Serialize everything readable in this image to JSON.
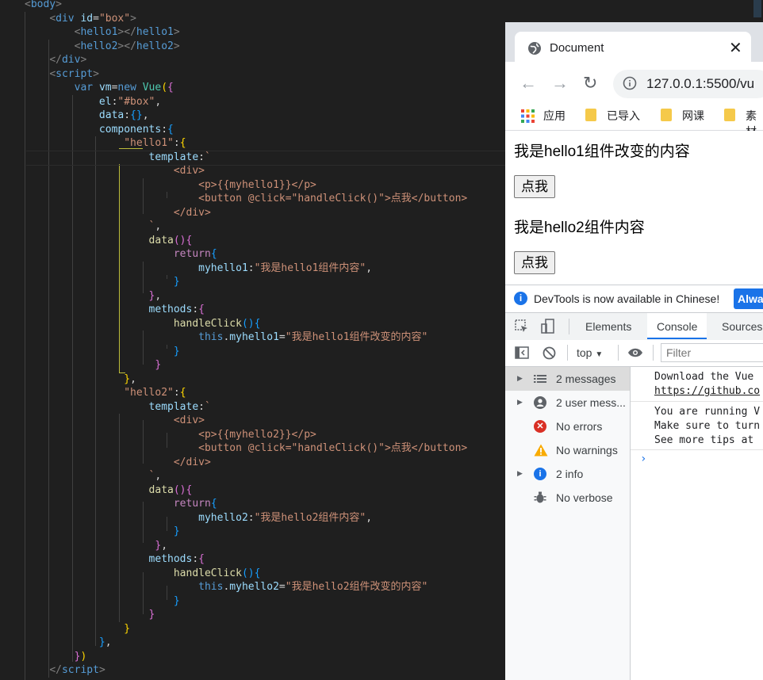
{
  "editor": {
    "lines": [
      [
        [
          "<",
          "p"
        ],
        [
          "body",
          "tag"
        ],
        [
          ">",
          "p"
        ]
      ],
      [
        [
          "    "
        ],
        [
          "<",
          "p"
        ],
        [
          "div",
          "tag"
        ],
        [
          " "
        ],
        [
          "id",
          "attr"
        ],
        [
          "=",
          "plain"
        ],
        [
          "\"box\"",
          "str"
        ],
        [
          ">",
          "p"
        ]
      ],
      [
        [
          "        "
        ],
        [
          "<",
          "p"
        ],
        [
          "hello1",
          "tag"
        ],
        [
          "></",
          "p"
        ],
        [
          "hello1",
          "tag"
        ],
        [
          ">",
          "p"
        ]
      ],
      [
        [
          "        "
        ],
        [
          "<",
          "p"
        ],
        [
          "hello2",
          "tag"
        ],
        [
          "></",
          "p"
        ],
        [
          "hello2",
          "tag"
        ],
        [
          ">",
          "p"
        ]
      ],
      [
        [
          "    "
        ],
        [
          "</",
          "p"
        ],
        [
          "div",
          "tag"
        ],
        [
          ">",
          "p"
        ]
      ],
      [
        [
          "    "
        ],
        [
          "<",
          "p"
        ],
        [
          "script",
          "tag"
        ],
        [
          ">",
          "p"
        ]
      ],
      [
        [
          "        "
        ],
        [
          "var ",
          "kw"
        ],
        [
          "vm",
          "var"
        ],
        [
          "=",
          "plain"
        ],
        [
          "new ",
          "kw"
        ],
        [
          "Vue",
          "cls"
        ],
        [
          "(",
          "br1"
        ],
        [
          "{",
          "br2"
        ]
      ],
      [
        [
          "            "
        ],
        [
          "el",
          "prop"
        ],
        [
          ":",
          "plain"
        ],
        [
          "\"#box\"",
          "str"
        ],
        [
          ",",
          "plain"
        ]
      ],
      [
        [
          "            "
        ],
        [
          "data",
          "prop"
        ],
        [
          ":",
          "plain"
        ],
        [
          "{}",
          "br3"
        ],
        [
          ",",
          "plain"
        ]
      ],
      [
        [
          "            "
        ],
        [
          "components",
          "prop"
        ],
        [
          ":",
          "plain"
        ],
        [
          "{",
          "br3"
        ]
      ],
      [
        [
          "                "
        ],
        [
          "\"hello1\"",
          "str"
        ],
        [
          ":",
          "plain"
        ],
        [
          "{",
          "br1"
        ]
      ],
      [
        [
          "                    "
        ],
        [
          "template",
          "prop"
        ],
        [
          ":",
          "plain"
        ],
        [
          "`",
          "str"
        ]
      ],
      [
        [
          "                        "
        ],
        [
          "<div>",
          "str"
        ]
      ],
      [
        [
          "                            "
        ],
        [
          "<p>{{myhello1}}</p>",
          "str"
        ]
      ],
      [
        [
          "                            "
        ],
        [
          "<button @click=\"handleClick()\">点我</button>",
          "str"
        ]
      ],
      [
        [
          "                        "
        ],
        [
          "</div>",
          "str"
        ]
      ],
      [
        [
          "                    "
        ],
        [
          "`",
          "str"
        ],
        [
          ",",
          "plain"
        ]
      ],
      [
        [
          "                    "
        ],
        [
          "data",
          "fn"
        ],
        [
          "()",
          "br2"
        ],
        [
          "{",
          "br2"
        ]
      ],
      [
        [
          "                        "
        ],
        [
          "return",
          "ctl"
        ],
        [
          "{",
          "br3"
        ]
      ],
      [
        [
          "                            "
        ],
        [
          "myhello1",
          "prop"
        ],
        [
          ":",
          "plain"
        ],
        [
          "\"我是hello1组件内容\"",
          "str"
        ],
        [
          ",",
          "plain"
        ]
      ],
      [
        [
          "                        "
        ],
        [
          "}",
          "br3"
        ]
      ],
      [
        [
          "                    "
        ],
        [
          "}",
          "br2"
        ],
        [
          ",",
          "plain"
        ]
      ],
      [
        [
          "                    "
        ],
        [
          "methods",
          "prop"
        ],
        [
          ":",
          "plain"
        ],
        [
          "{",
          "br2"
        ]
      ],
      [
        [
          "                        "
        ],
        [
          "handleClick",
          "fn"
        ],
        [
          "()",
          "br3"
        ],
        [
          "{",
          "br3"
        ]
      ],
      [
        [
          "                            "
        ],
        [
          "this",
          "kw"
        ],
        [
          ".",
          "plain"
        ],
        [
          "myhello1",
          "prop"
        ],
        [
          "=",
          "plain"
        ],
        [
          "\"我是hello1组件改变的内容\"",
          "str"
        ]
      ],
      [
        [
          "                        "
        ],
        [
          "}",
          "br3"
        ]
      ],
      [
        [
          "                     "
        ],
        [
          "}",
          "br2"
        ]
      ],
      [
        [
          "                "
        ],
        [
          "}",
          "br1"
        ],
        [
          ",",
          "plain"
        ]
      ],
      [
        [
          "                "
        ],
        [
          "\"hello2\"",
          "str"
        ],
        [
          ":",
          "plain"
        ],
        [
          "{",
          "br1"
        ]
      ],
      [
        [
          "                    "
        ],
        [
          "template",
          "prop"
        ],
        [
          ":",
          "plain"
        ],
        [
          "`",
          "str"
        ]
      ],
      [
        [
          "                        "
        ],
        [
          "<div>",
          "str"
        ]
      ],
      [
        [
          "                            "
        ],
        [
          "<p>{{myhello2}}</p>",
          "str"
        ]
      ],
      [
        [
          "                            "
        ],
        [
          "<button @click=\"handleClick()\">点我</button>",
          "str"
        ]
      ],
      [
        [
          "                        "
        ],
        [
          "</div>",
          "str"
        ]
      ],
      [
        [
          "                    "
        ],
        [
          "`",
          "str"
        ],
        [
          ",",
          "plain"
        ]
      ],
      [
        [
          "                    "
        ],
        [
          "data",
          "fn"
        ],
        [
          "()",
          "br2"
        ],
        [
          "{",
          "br2"
        ]
      ],
      [
        [
          "                        "
        ],
        [
          "return",
          "ctl"
        ],
        [
          "{",
          "br3"
        ]
      ],
      [
        [
          "                            "
        ],
        [
          "myhello2",
          "prop"
        ],
        [
          ":",
          "plain"
        ],
        [
          "\"我是hello2组件内容\"",
          "str"
        ],
        [
          ",",
          "plain"
        ]
      ],
      [
        [
          "                        "
        ],
        [
          "}",
          "br3"
        ]
      ],
      [
        [
          "                     "
        ],
        [
          "}",
          "br2"
        ],
        [
          ",",
          "plain"
        ]
      ],
      [
        [
          "                    "
        ],
        [
          "methods",
          "prop"
        ],
        [
          ":",
          "plain"
        ],
        [
          "{",
          "br2"
        ]
      ],
      [
        [
          "                        "
        ],
        [
          "handleClick",
          "fn"
        ],
        [
          "()",
          "br3"
        ],
        [
          "{",
          "br3"
        ]
      ],
      [
        [
          "                            "
        ],
        [
          "this",
          "kw"
        ],
        [
          ".",
          "plain"
        ],
        [
          "myhello2",
          "prop"
        ],
        [
          "=",
          "plain"
        ],
        [
          "\"我是hello2组件改变的内容\"",
          "str"
        ]
      ],
      [
        [
          "                        "
        ],
        [
          "}",
          "br3"
        ]
      ],
      [
        [
          "                    "
        ],
        [
          "}",
          "br2"
        ]
      ],
      [
        [
          "                "
        ],
        [
          "}",
          "br1"
        ]
      ],
      [
        [
          "            "
        ],
        [
          "}",
          "br3"
        ],
        [
          ",",
          "plain"
        ]
      ],
      [
        [
          "        "
        ],
        [
          "}",
          "br2"
        ],
        [
          ")",
          "br1"
        ]
      ],
      [
        [
          "    "
        ],
        [
          "</",
          "p"
        ],
        [
          "script",
          "tag"
        ],
        [
          ">",
          "p"
        ]
      ]
    ]
  },
  "browser": {
    "tab_title": "Document",
    "tab_close": "✕",
    "url": "127.0.0.1:5500/vu",
    "bookmarks": [
      "应用",
      "已导入",
      "网课",
      "素材"
    ],
    "page": {
      "text1": "我是hello1组件改变的内容",
      "button1": "点我",
      "text2": "我是hello2组件内容",
      "button2": "点我"
    }
  },
  "devtools": {
    "notice": "DevTools is now available in Chinese!",
    "notice_button": "Alwa",
    "tabs": [
      "Elements",
      "Console",
      "Sources"
    ],
    "context": "top",
    "filter_placeholder": "Filter",
    "sidebar": [
      {
        "label": "2 messages",
        "icon": "list-icon"
      },
      {
        "label": "2 user mess...",
        "icon": "user-icon"
      },
      {
        "label": "No errors",
        "icon": "error-icon"
      },
      {
        "label": "No warnings",
        "icon": "warning-icon"
      },
      {
        "label": "2 info",
        "icon": "info-icon"
      },
      {
        "label": "No verbose",
        "icon": "bug-icon"
      }
    ],
    "console_lines": [
      "Download the Vue",
      "https://github.co",
      "You are running V",
      "Make sure to turn",
      "See more tips at"
    ],
    "colors": {
      "accent": "#1a73e8",
      "error": "#d93025",
      "warning": "#f9ab00"
    }
  }
}
